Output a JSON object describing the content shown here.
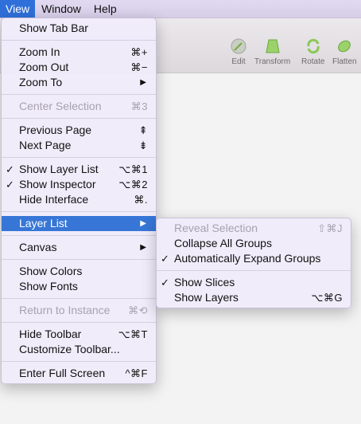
{
  "menubar": {
    "items": [
      "View",
      "Window",
      "Help"
    ]
  },
  "toolbar": {
    "tools": [
      {
        "label": "Edit",
        "icon": "edit-icon"
      },
      {
        "label": "Transform",
        "icon": "transform-icon"
      },
      {
        "label": "Rotate",
        "icon": "rotate-icon"
      },
      {
        "label": "Flatten",
        "icon": "flatten-icon"
      }
    ]
  },
  "view_menu": {
    "groups": [
      [
        {
          "label": "Show Tab Bar"
        }
      ],
      [
        {
          "label": "Zoom In",
          "shortcut": "⌘+"
        },
        {
          "label": "Zoom Out",
          "shortcut": "⌘−"
        },
        {
          "label": "Zoom To",
          "submenu": "▶"
        }
      ],
      [
        {
          "label": "Center Selection",
          "shortcut": "⌘3",
          "disabled": true
        }
      ],
      [
        {
          "label": "Previous Page",
          "shortcut": "⇞"
        },
        {
          "label": "Next Page",
          "shortcut": "⇟"
        }
      ],
      [
        {
          "label": "Show Layer List",
          "shortcut": "⌥⌘1",
          "checked": true
        },
        {
          "label": "Show Inspector",
          "shortcut": "⌥⌘2",
          "checked": true
        },
        {
          "label": "Hide Interface",
          "shortcut": "⌘."
        }
      ],
      [
        {
          "label": "Layer List",
          "submenu": "▶",
          "highlighted": true
        }
      ],
      [
        {
          "label": "Canvas",
          "submenu": "▶"
        }
      ],
      [
        {
          "label": "Show Colors"
        },
        {
          "label": "Show Fonts"
        }
      ],
      [
        {
          "label": "Return to Instance",
          "shortcut": "⌘⟲",
          "disabled": true
        }
      ],
      [
        {
          "label": "Hide Toolbar",
          "shortcut": "⌥⌘T"
        },
        {
          "label": "Customize Toolbar..."
        }
      ],
      [
        {
          "label": "Enter Full Screen",
          "shortcut": "^⌘F"
        }
      ]
    ]
  },
  "layer_list_submenu": {
    "groups": [
      [
        {
          "label": "Reveal Selection",
          "shortcut": "⇧⌘J",
          "disabled": true
        },
        {
          "label": "Collapse All Groups"
        },
        {
          "label": "Automatically Expand Groups",
          "checked": true
        }
      ],
      [
        {
          "label": "Show Slices",
          "checked": true
        },
        {
          "label": "Show Layers",
          "shortcut": "⌥⌘G"
        }
      ]
    ]
  },
  "checkmark": "✓",
  "colors": {
    "highlight": "#3776d6",
    "menubar_active": "#2f6fd9",
    "disabled_text": "#a7a2ae",
    "tool_icon": "#9bd36a"
  }
}
